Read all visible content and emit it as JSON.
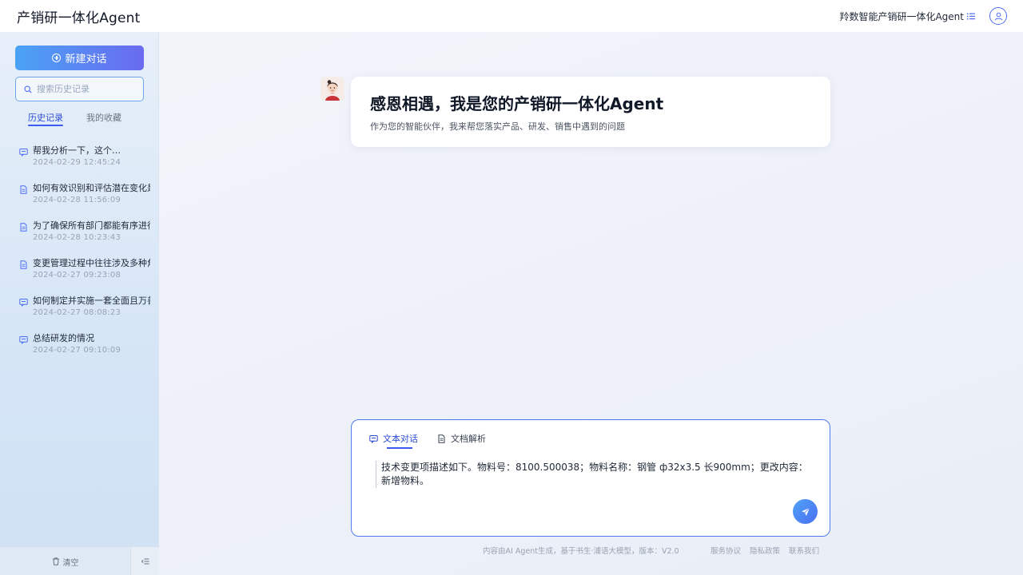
{
  "header": {
    "app_title": "产销研一体化Agent",
    "org_name": "羚数智能产销研一体化Agent",
    "list_icon": "list-icon",
    "user_icon": "user-icon"
  },
  "sidebar": {
    "new_chat_label": "新建对话",
    "search_placeholder": "搜索历史记录",
    "tabs": [
      {
        "label": "历史记录",
        "active": true
      },
      {
        "label": "我的收藏",
        "active": false
      }
    ],
    "history": [
      {
        "title": "帮我分析一下，这个…",
        "time": "2024-02-29  12:45:24",
        "icon": "chat-icon"
      },
      {
        "title": "如何有效识别和评估潜在变化是",
        "time": "2024-02-28  11:56:09",
        "icon": "document-icon"
      },
      {
        "title": "为了确保所有部门都能有序进行",
        "time": "2024-02-28  10:23:43",
        "icon": "document-icon"
      },
      {
        "title": "变更管理过程中往往涉及多种角",
        "time": "2024-02-27  09:23:08",
        "icon": "document-icon"
      },
      {
        "title": "如何制定并实施一套全面且万善",
        "time": "2024-02-27  08:08:23",
        "icon": "chat-icon"
      },
      {
        "title": "总结研发的情况",
        "time": "2024-02-27  09:10:09",
        "icon": "chat-icon"
      }
    ],
    "clear_label": "清空"
  },
  "main": {
    "welcome_title": "感恩相遇，我是您的产销研一体化Agent",
    "welcome_subtitle": "作为您的智能伙伴，我来帮您落实产品、研发、销售中遇到的问题",
    "mode_tabs": [
      {
        "label": "文本对话",
        "active": true
      },
      {
        "label": "文档解析",
        "active": false
      }
    ],
    "input_value": "技术变更项描述如下。物料号：8100.500038；物料名称：钢管 ф32x3.5 长900mm；更改内容：新增物料。",
    "footer_disclaimer": "内容由AI Agent生成，基于书生·浦语大模型，版本：V2.0",
    "footer_links": [
      "服务协议",
      "隐私政策",
      "联系我们"
    ]
  },
  "colors": {
    "accent": "#3e5bf0",
    "button_gradient_start": "#4aa3f5",
    "button_gradient_end": "#6a6af0"
  }
}
